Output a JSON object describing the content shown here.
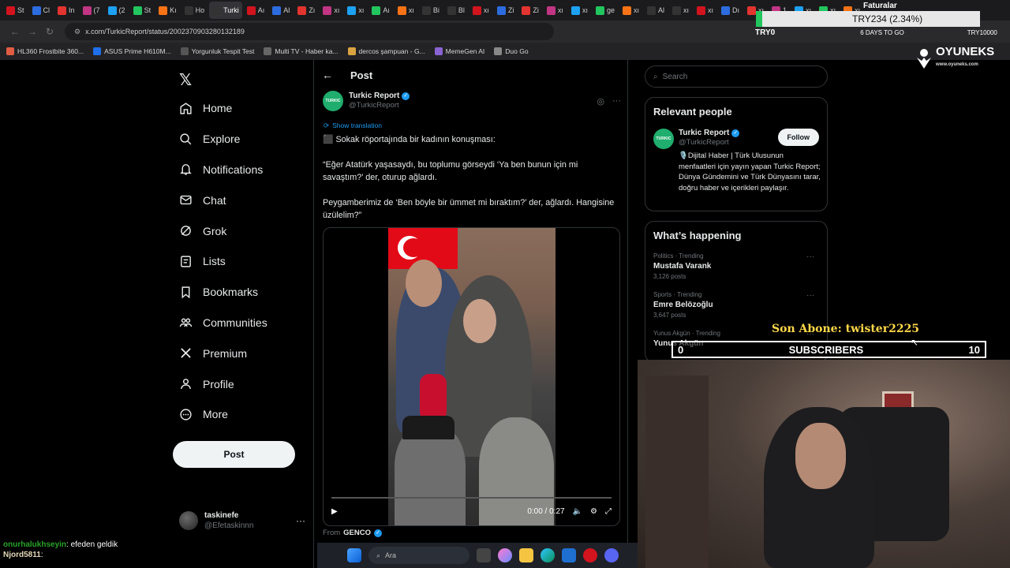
{
  "browser": {
    "tabs": [
      "St",
      "Cl",
      "In",
      "(7",
      "(2",
      "St",
      "Kı",
      "Ho",
      "Turki",
      "Aı",
      "Al",
      "Zı",
      "xı",
      "xı",
      "Aı",
      "xı",
      "Bi",
      "Bl",
      "xı",
      "Zi",
      "Zi",
      "xı",
      "xı",
      "ge",
      "xı",
      "Al",
      "xı",
      "xı",
      "Dı",
      "xı",
      "1",
      "xı",
      "xı",
      "xı"
    ],
    "url": "x.com/TurkicReport/status/2002370903280132189",
    "bookmarks": [
      "HL360 Frostbite 360...",
      "ASUS Prime H610M...",
      "Yorgunluk Tespit Test",
      "Multi TV - Haber ka...",
      "dercos şampuan - G...",
      "MemeGen AI",
      "Duo Go"
    ]
  },
  "sidebar": {
    "items": [
      {
        "label": "Home",
        "icon": "home-icon"
      },
      {
        "label": "Explore",
        "icon": "search-icon"
      },
      {
        "label": "Notifications",
        "icon": "bell-icon"
      },
      {
        "label": "Chat",
        "icon": "mail-icon"
      },
      {
        "label": "Grok",
        "icon": "grok-icon"
      },
      {
        "label": "Lists",
        "icon": "list-icon"
      },
      {
        "label": "Bookmarks",
        "icon": "bookmark-icon"
      },
      {
        "label": "Communities",
        "icon": "people-icon"
      },
      {
        "label": "Premium",
        "icon": "x-logo-icon"
      },
      {
        "label": "Profile",
        "icon": "person-icon"
      },
      {
        "label": "More",
        "icon": "more-circle-icon"
      }
    ],
    "post_label": "Post",
    "account": {
      "name": "taskinefe",
      "handle": "@Efetaskinnn"
    }
  },
  "post": {
    "header": "Post",
    "author_name": "Turkic Report",
    "author_handle": "@TurkicReport",
    "avatar_text": "TURKIC",
    "show_translation": "Show translation",
    "paragraphs": [
      "⬛ Sokak röportajında bir kadının konuşması:",
      "“Eğer Atatürk yaşasaydı, bu toplumu görseydi ‘Ya ben bunun için mi savaştım?’ der, oturup ağlardı.",
      "Peygamberimiz de ‘Ben böyle bir ümmet mi bıraktım?’ der, ağlardı. Hangisine üzülelim?”"
    ],
    "video_time": "0:00 / 0:27",
    "from_label": "From",
    "from_name": "GENCO"
  },
  "right": {
    "search_placeholder": "Search",
    "relevant_title": "Relevant people",
    "person": {
      "name": "Turkic Report",
      "handle": "@TurkicReport",
      "follow_label": "Follow",
      "bio": "🎙️Dijital Haber | Türk Ulusunun menfaatleri için yayın yapan Turkic Report; Dünya Gündemini ve Türk Dünyasını tarar, doğru haber ve içerikleri paylaşır."
    },
    "happening_title": "What’s happening",
    "trends": [
      {
        "category": "Politics · Trending",
        "title": "Mustafa Varank",
        "count": "3,126 posts"
      },
      {
        "category": "Sports · Trending",
        "title": "Emre Belözoğlu",
        "count": "3,647 posts"
      },
      {
        "category": "Yunus Akgün · Trending",
        "title": "Yunus Akgün",
        "count": ""
      }
    ]
  },
  "overlay": {
    "currency": "TRY234 (2.34%)",
    "faturalar": "Faturalar",
    "try0": "TRY0",
    "days_to_go": "6 DAYS TO GO",
    "try_right": "TRY10000",
    "brand": "OYUNEKS",
    "brand_sub": "www.oyuneks.com",
    "son_abone": "Son Abone: twister2225",
    "subs_left": "0",
    "subs_label": "SUBSCRIBERS",
    "subs_right": "10"
  },
  "chat": [
    {
      "user": "onurhalukhseyin",
      "msg": ": efeden geldik"
    },
    {
      "user": "Njord5811",
      "msg": ":"
    }
  ],
  "taskbar": {
    "search_label": "Ara"
  },
  "colors": {
    "accent": "#1d9bf0",
    "bg": "#000000",
    "border": "#2f3336",
    "muted": "#71767b",
    "gold": "#ffd84a"
  }
}
